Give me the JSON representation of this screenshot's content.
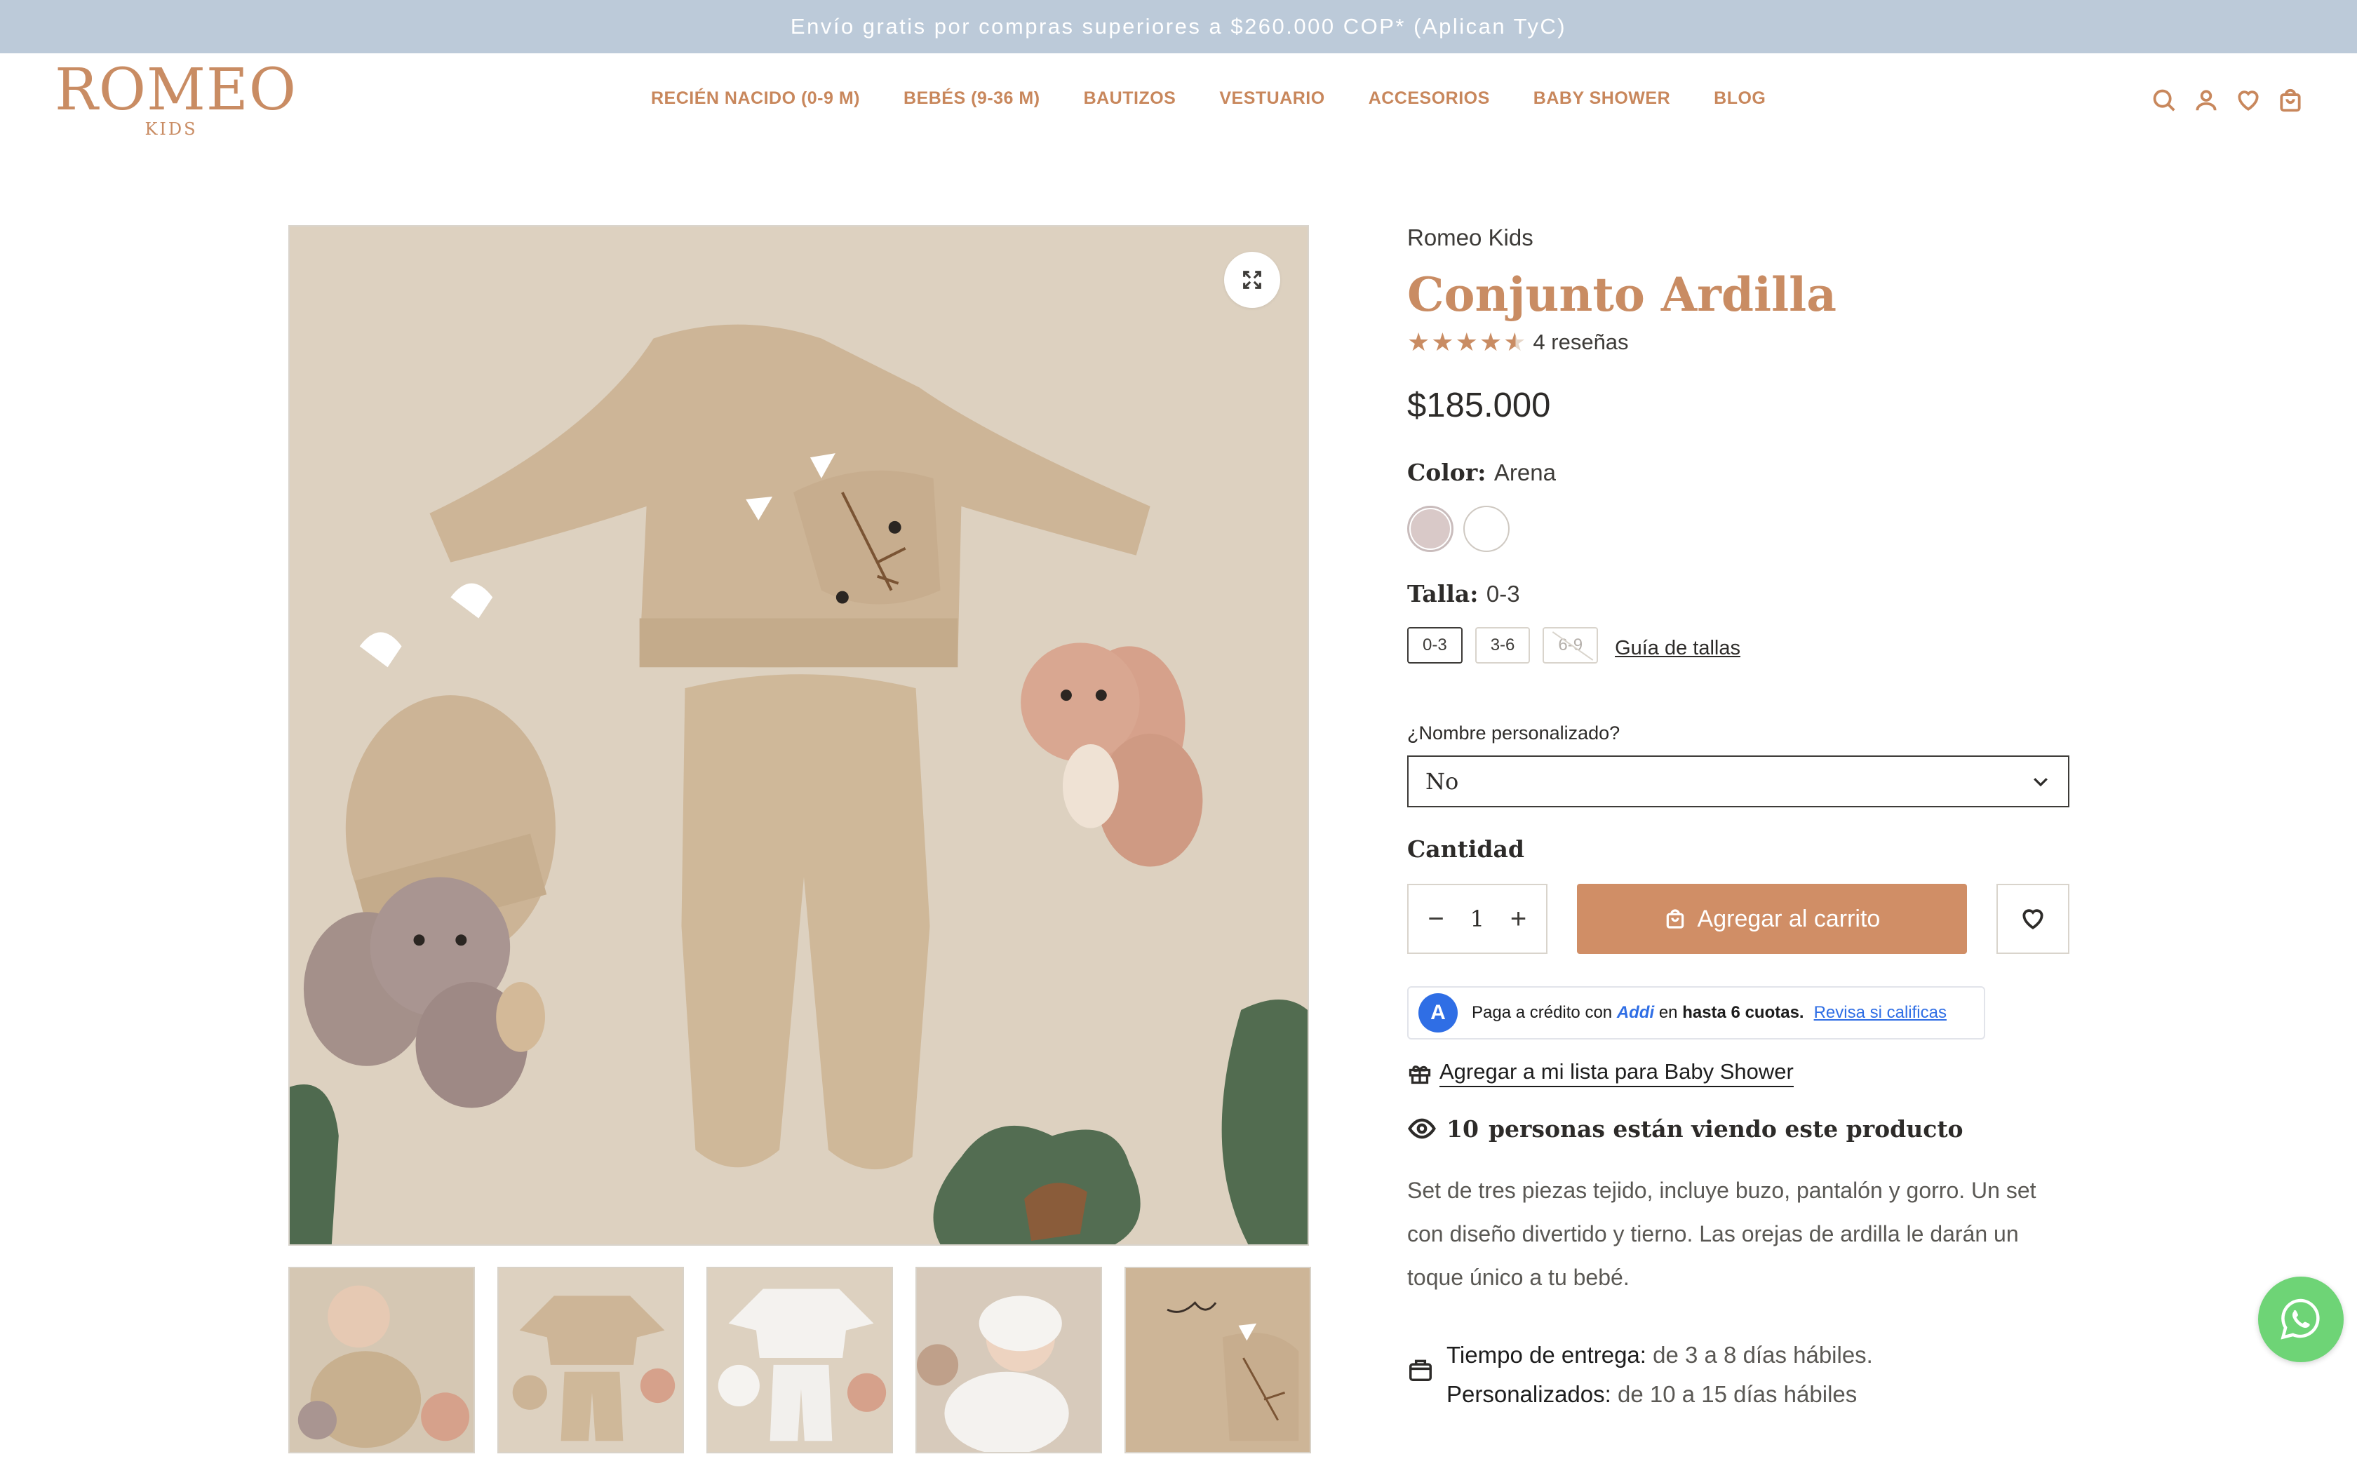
{
  "announcement": "Envío gratis por compras superiores a $260.000 COP* (Aplican TyC)",
  "logo": {
    "name": "ROMEO",
    "sub": "KIDS"
  },
  "nav": [
    "RECIÉN NACIDO (0-9 M)",
    "BEBÉS (9-36 M)",
    "BAUTIZOS",
    "VESTUARIO",
    "ACCESORIOS",
    "BABY SHOWER",
    "BLOG"
  ],
  "header_icons": [
    "search-icon",
    "account-icon",
    "heart-icon",
    "cart-icon"
  ],
  "product": {
    "vendor": "Romeo Kids",
    "title": "Conjunto Ardilla",
    "rating": 4.5,
    "reviews": "4 reseñas",
    "price": "$185.000",
    "color_label": "Color:",
    "color_value": "Arena",
    "swatches": [
      {
        "name": "Arena",
        "color": "#d9c9c8",
        "selected": true
      },
      {
        "name": "Blanco",
        "color": "#ffffff",
        "selected": false
      }
    ],
    "size_label": "Talla:",
    "size_value": "0-3",
    "sizes": [
      {
        "label": "0-3",
        "state": "selected"
      },
      {
        "label": "3-6",
        "state": "available"
      },
      {
        "label": "6-9",
        "state": "unavailable"
      }
    ],
    "size_guide": "Guía de tallas",
    "personalization_label": "¿Nombre personalizado?",
    "personalization_value": "No",
    "quantity_label": "Cantidad",
    "quantity": "1",
    "qty_minus": "−",
    "qty_plus": "+",
    "add_to_cart": "Agregar al carrito",
    "addi": {
      "logo_letter": "A",
      "prefix": "Paga a crédito con",
      "brand": "Addi",
      "middle": "en",
      "bold": "hasta 6 cuotas.",
      "link": "Revisa si calificas"
    },
    "registry": "Agregar a mi lista para Baby Shower",
    "viewing_count": "10",
    "viewing_text": "personas están viendo este producto",
    "description": "Set de tres piezas tejido, incluye buzo, pantalón y gorro. Un set con diseño divertido y tierno. Las orejas de ardilla le darán un toque único a tu bebé.",
    "delivery_label": "Tiempo de entrega:",
    "delivery_value": "de 3 a 8 días hábiles.",
    "custom_label": "Personalizados:",
    "custom_value": "de 10 a 15 días hábiles"
  },
  "colors": {
    "accent": "#c98c63",
    "announcement_bg": "#bccad9",
    "button": "#d08e66",
    "addi_blue": "#2f6ee5",
    "whatsapp": "#6ed476"
  }
}
